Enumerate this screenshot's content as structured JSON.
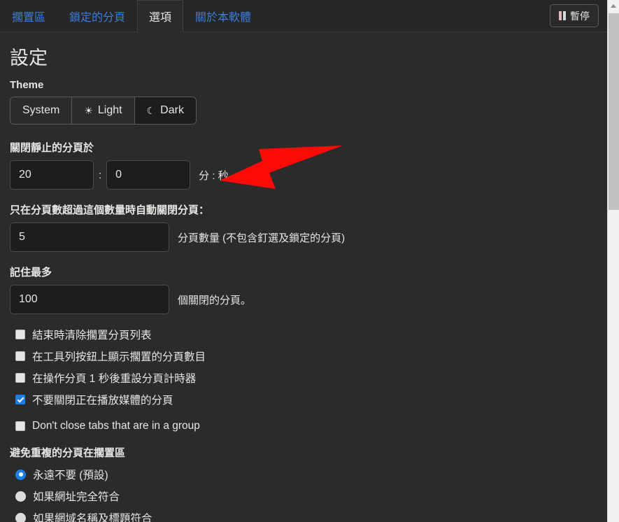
{
  "tabbar": {
    "tabs": [
      {
        "label": "擱置區",
        "active": false
      },
      {
        "label": "鎖定的分頁",
        "active": false
      },
      {
        "label": "選項",
        "active": true
      },
      {
        "label": "關於本軟體",
        "active": false
      }
    ],
    "pause_button": {
      "label": "暫停",
      "icon": "pause-icon"
    }
  },
  "page": {
    "title": "設定"
  },
  "theme": {
    "label": "Theme",
    "options": [
      {
        "label": "System",
        "icon": "",
        "selected": false
      },
      {
        "label": "Light",
        "icon": "☀",
        "selected": false
      },
      {
        "label": "Dark",
        "icon": "☾",
        "selected": true
      }
    ]
  },
  "idle_timeout": {
    "label": "關閉靜止的分頁於",
    "minutes": "20",
    "seconds": "0",
    "separator": ":",
    "unit": "分 : 秒"
  },
  "min_tabs": {
    "label": "只在分頁數超過這個數量時自動關閉分頁：",
    "value": "5",
    "unit": "分頁數量 (不包含釘選及鎖定的分頁)"
  },
  "max_remember": {
    "label": "記住最多",
    "value": "100",
    "unit": "個關閉的分頁。"
  },
  "checkboxes": [
    {
      "label": "結束時清除擱置分頁列表",
      "checked": false
    },
    {
      "label": "在工具列按鈕上顯示擱置的分頁數目",
      "checked": false
    },
    {
      "label": "在操作分頁 1 秒後重設分頁計時器",
      "checked": false
    },
    {
      "label": "不要關閉正在播放媒體的分頁",
      "checked": true
    },
    {
      "label": "Don't close tabs that are in a group",
      "checked": false
    }
  ],
  "dedupe": {
    "label": "避免重複的分頁在擱置區",
    "options": [
      {
        "label": "永遠不要 (預設)",
        "selected": true
      },
      {
        "label": "如果網址完全符合",
        "selected": false
      },
      {
        "label": "如果網域名稱及標題符合",
        "selected": false
      }
    ]
  },
  "annotation": {
    "type": "arrow",
    "color": "#fb0a08",
    "direction": "points-left"
  },
  "colors": {
    "background": "#2b2b2b",
    "tabbar": "#262626",
    "link": "#3b7ddd",
    "accent": "#1b7fe8",
    "text": "#e8e6e3",
    "input_bg": "#1d1d1d"
  },
  "scrollbar": {
    "icon": "scroll-up-arrow-icon",
    "track_color": "#f1f1f1",
    "thumb_color": "#c1c1c1"
  }
}
